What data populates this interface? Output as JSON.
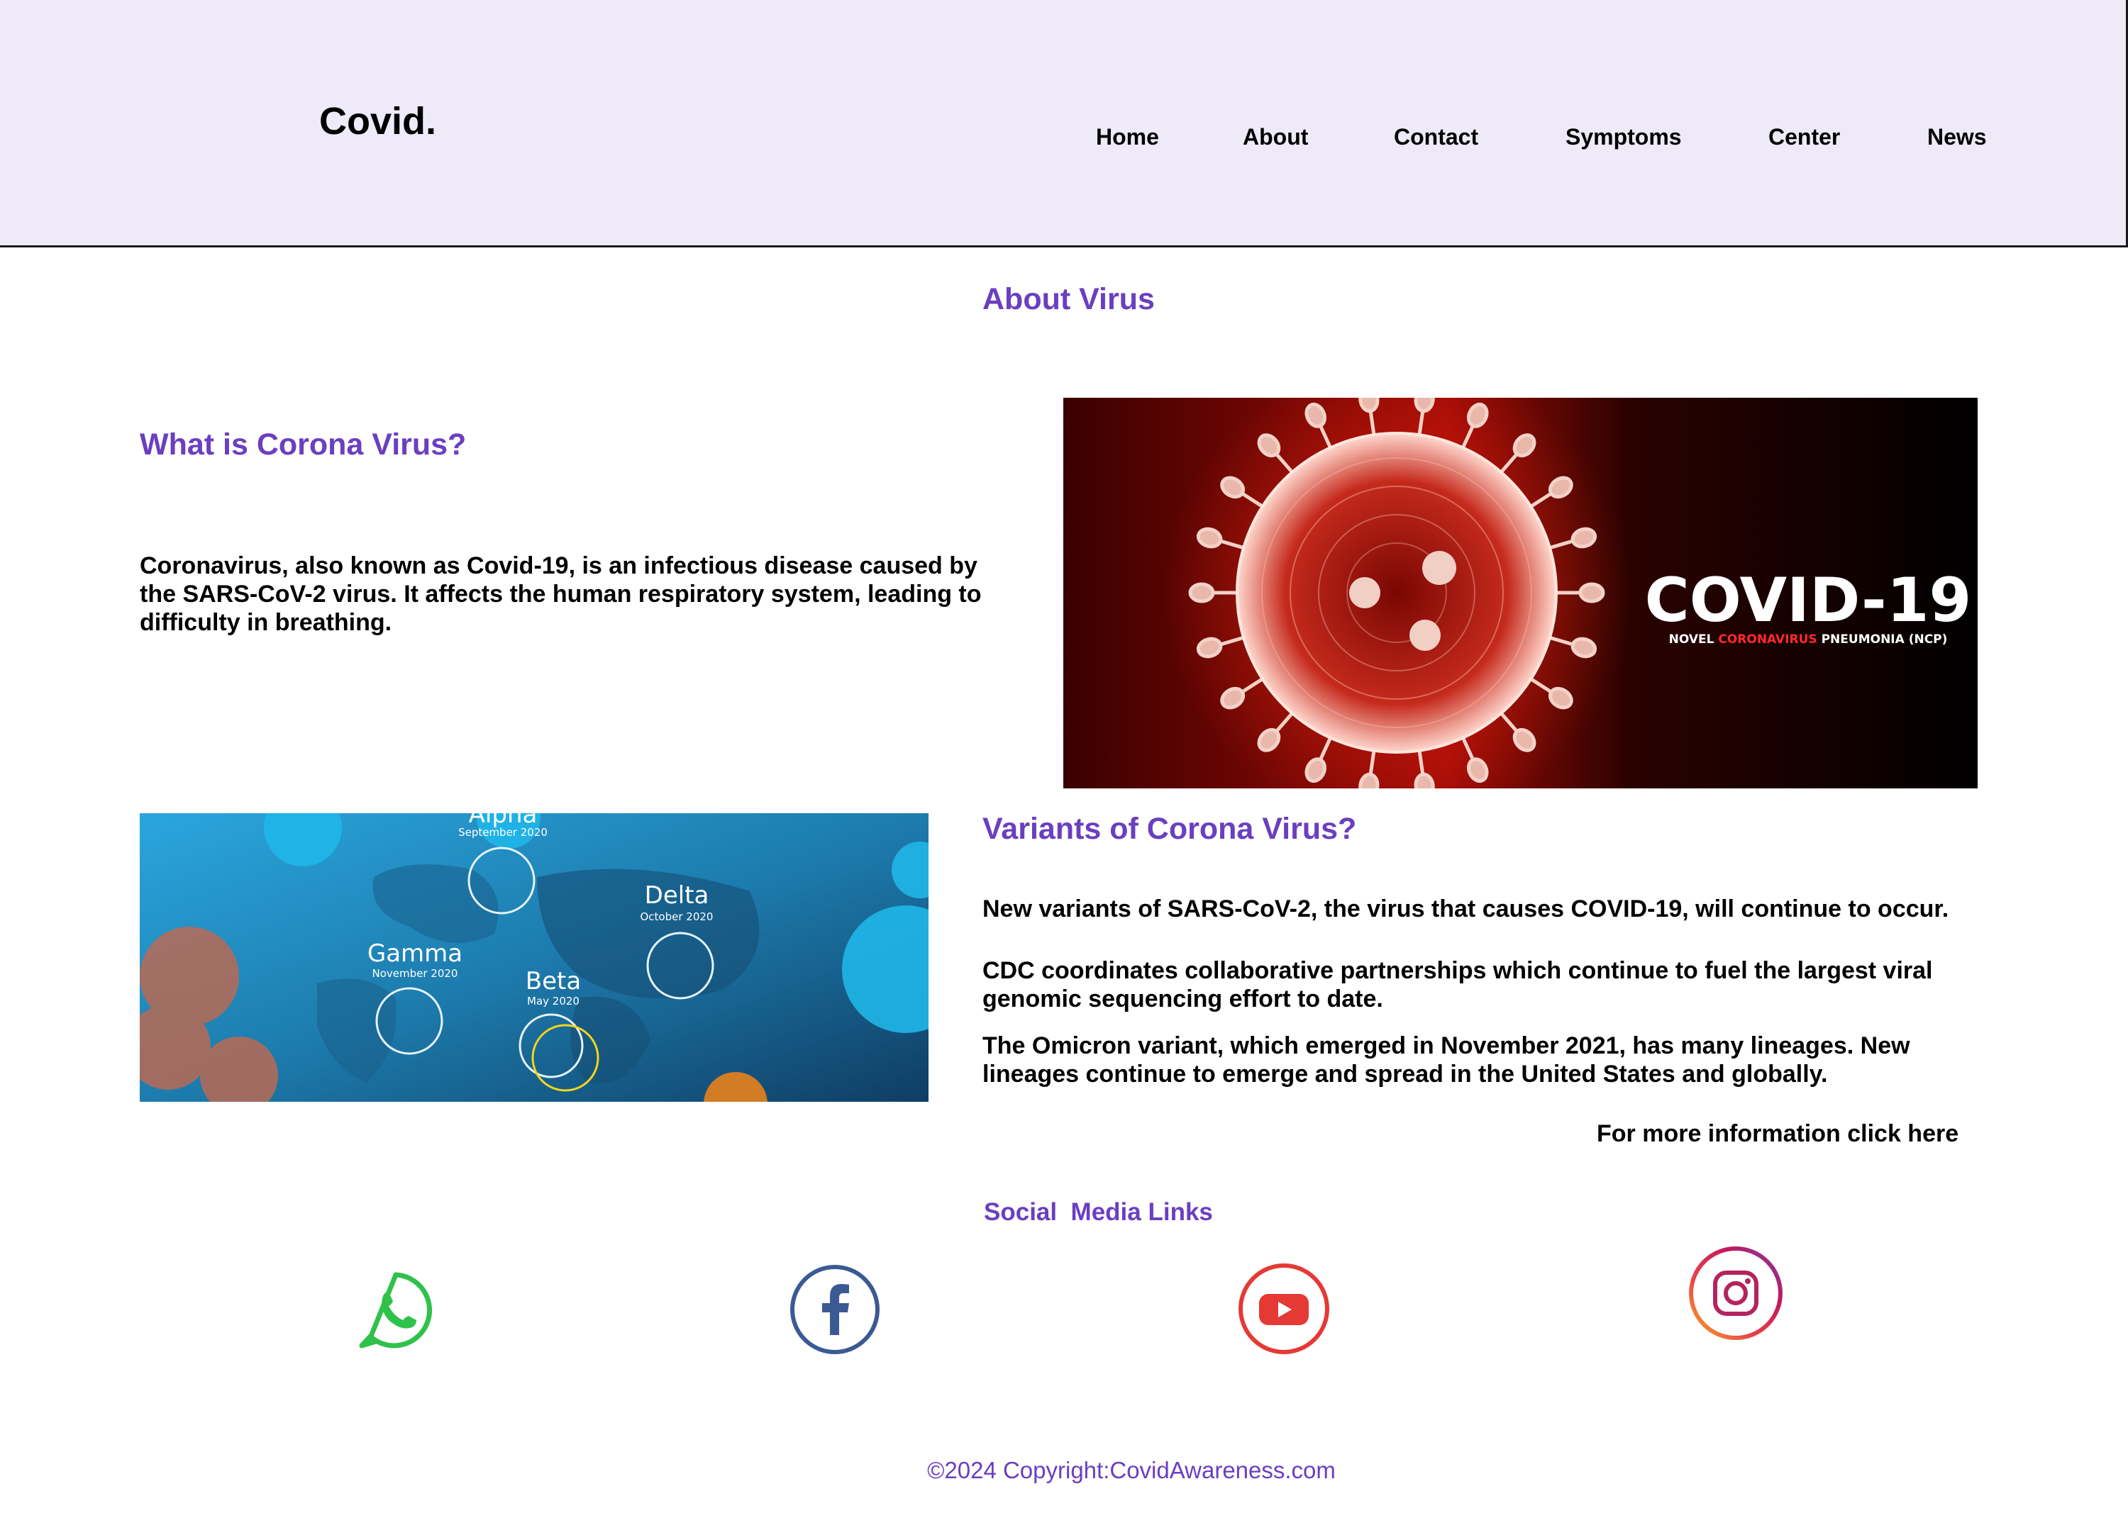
{
  "header": {
    "brand": "Covid.",
    "nav": [
      "Home",
      "About",
      "Contact",
      "Symptoms",
      "Center",
      "News"
    ]
  },
  "about": {
    "heading": "About Virus",
    "what_title": "What is Corona Virus?",
    "what_text": "Coronavirus, also known as Covid-19, is an infectious disease caused by the SARS-CoV-2 virus. It affects the human respiratory system, leading to difficulty in breathing.",
    "banner": {
      "title": "COVID-19",
      "subtitle_prefix": "NOVEL ",
      "subtitle_highlight": "CORONAVIRUS",
      "subtitle_suffix": " PNEUMONIA (NCP)"
    }
  },
  "variants": {
    "title": "Variants of  Corona Virus?",
    "p1": "New variants of SARS-CoV-2, the virus that causes COVID-19, will continue to occur.",
    "p2": "CDC coordinates collaborative partnerships which continue to fuel the largest viral genomic sequencing effort to date.",
    "p3": "The Omicron variant, which emerged in November 2021, has many lineages. New lineages continue to emerge and spread in the United States and globally.",
    "more_link": "For more information click here",
    "map_labels": [
      {
        "name": "Alpha",
        "date": "September 2020"
      },
      {
        "name": "Delta",
        "date": "October 2020"
      },
      {
        "name": "Gamma",
        "date": "November 2020"
      },
      {
        "name": "Beta",
        "date": "May 2020"
      }
    ]
  },
  "social": {
    "title": "Social  Media Links",
    "icons": [
      "whatsapp-icon",
      "facebook-icon",
      "youtube-icon",
      "instagram-icon"
    ]
  },
  "footer": {
    "copyright": "©2024 Copyright:CovidAwareness.com"
  },
  "colors": {
    "accent": "#6a3fc0",
    "header_bg": "#eeeaf8",
    "whatsapp": "#2fc24a",
    "facebook": "#3b5a94",
    "youtube": "#e53935"
  }
}
